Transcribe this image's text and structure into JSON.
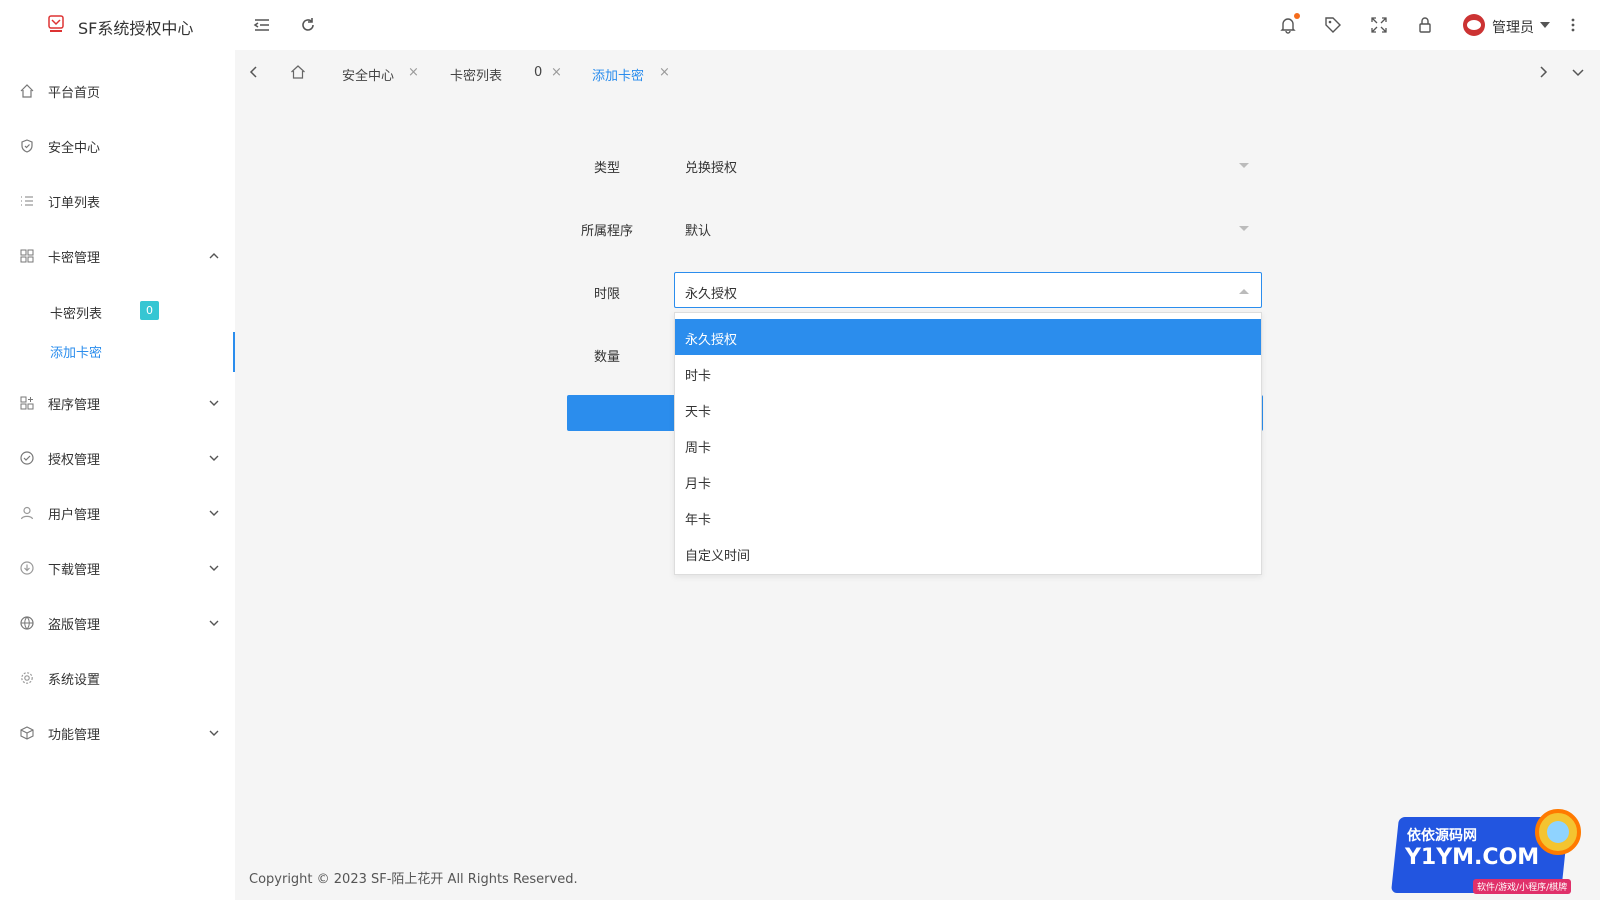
{
  "header": {
    "app_title": "SF系统授权中心",
    "user_name": "管理员"
  },
  "sidebar": {
    "items": [
      {
        "label": "平台首页",
        "icon": "home-icon"
      },
      {
        "label": "安全中心",
        "icon": "shield-icon"
      },
      {
        "label": "订单列表",
        "icon": "list-icon"
      },
      {
        "label": "卡密管理",
        "icon": "grid-icon",
        "expanded": true
      },
      {
        "label": "程序管理",
        "icon": "apps-icon"
      },
      {
        "label": "授权管理",
        "icon": "check-circle-icon"
      },
      {
        "label": "用户管理",
        "icon": "user-icon"
      },
      {
        "label": "下载管理",
        "icon": "download-icon"
      },
      {
        "label": "盗版管理",
        "icon": "globe-icon"
      },
      {
        "label": "系统设置",
        "icon": "gear-icon"
      },
      {
        "label": "功能管理",
        "icon": "cube-icon"
      }
    ],
    "subitems": [
      {
        "label": "卡密列表",
        "badge": "0"
      },
      {
        "label": "添加卡密",
        "active": true
      }
    ]
  },
  "tabs": [
    {
      "label": "安全中心",
      "closable": true
    },
    {
      "label": "卡密列表",
      "closable": false
    },
    {
      "label": "0",
      "closable": true
    },
    {
      "label": "添加卡密",
      "closable": true,
      "active": true
    }
  ],
  "form": {
    "type_label": "类型",
    "type_value": "兑换授权",
    "program_label": "所属程序",
    "program_value": "默认",
    "duration_label": "时限",
    "duration_value": "永久授权",
    "quantity_label": "数量"
  },
  "dropdown": {
    "options": [
      "永久授权",
      "时卡",
      "天卡",
      "周卡",
      "月卡",
      "年卡",
      "自定义时间"
    ],
    "selected_index": 0
  },
  "footer": {
    "text": "Copyright © 2023 SF-陌上花开 All Rights Reserved."
  },
  "watermark": {
    "line1": "依依源码网",
    "line2": "Y1YM.COM",
    "line3": "软件/游戏/小程序/棋牌"
  },
  "colors": {
    "accent": "#2b8ded",
    "badge": "#36c6d3",
    "notification_dot": "#f56c1c"
  }
}
